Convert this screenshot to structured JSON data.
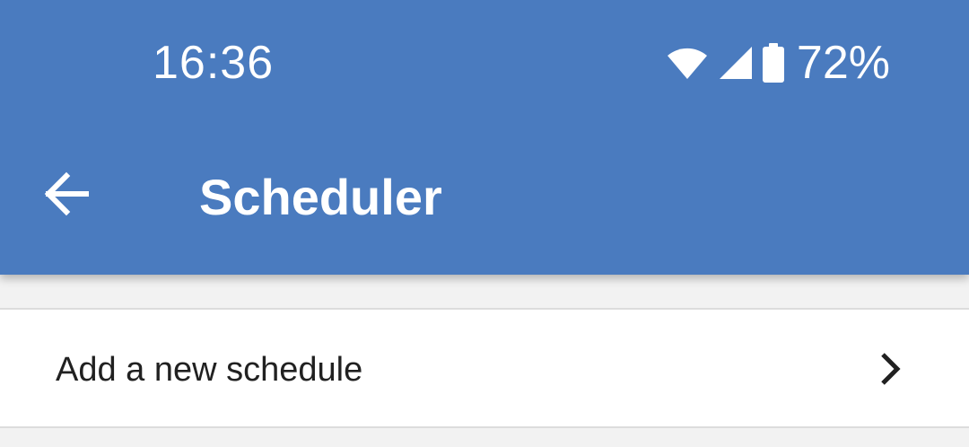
{
  "status_bar": {
    "time": "16:36",
    "battery_percent": "72%",
    "icons": [
      "wifi-icon",
      "signal-icon",
      "battery-icon"
    ]
  },
  "app_bar": {
    "title": "Scheduler",
    "back_icon": "arrow-left-icon",
    "color": "#4a7bbf"
  },
  "list": {
    "items": [
      {
        "label": "Add a new schedule",
        "icon": "chevron-right-icon"
      }
    ]
  }
}
